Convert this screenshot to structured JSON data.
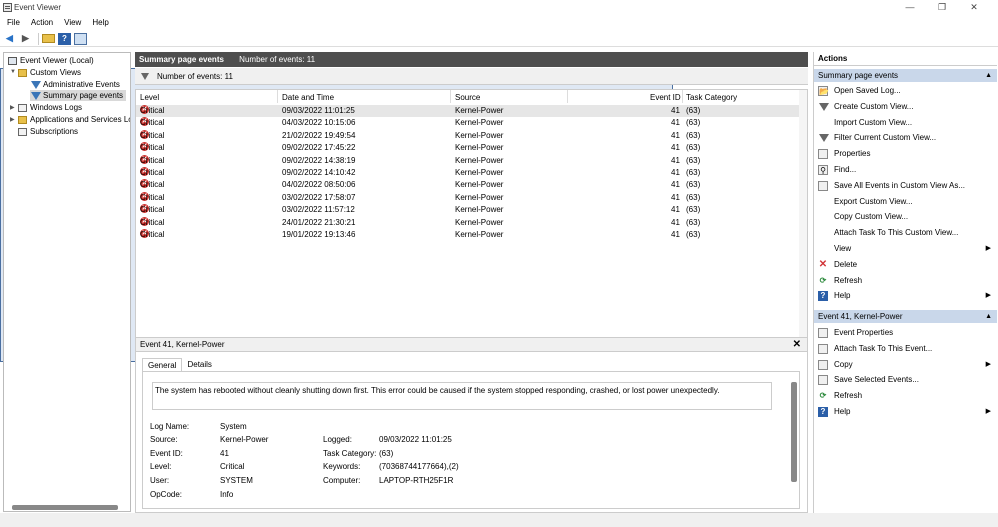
{
  "window": {
    "title": "Event Viewer",
    "controls": [
      "—",
      "❐",
      "✕"
    ]
  },
  "menu": [
    "File",
    "Action",
    "View",
    "Help"
  ],
  "tree": {
    "root": "Event Viewer (Local)",
    "custom_views": "Custom Views",
    "admin_events": "Administrative Events",
    "summary": "Summary page events",
    "windows_logs": "Windows Logs",
    "app_services": "Applications and Services Logs",
    "subscriptions": "Subscriptions"
  },
  "center": {
    "title": "Summary page events",
    "count_label": "Number of events: 11",
    "filter_label": "Number of events: 11",
    "columns": [
      "Level",
      "Date and Time",
      "Source",
      "Event ID",
      "Task Category"
    ],
    "rows": [
      {
        "level": "Critical",
        "datetime": "09/03/2022 11:01:25",
        "source": "Kernel-Power",
        "id": "41",
        "cat": "(63)"
      },
      {
        "level": "Critical",
        "datetime": "04/03/2022 10:15:06",
        "source": "Kernel-Power",
        "id": "41",
        "cat": "(63)"
      },
      {
        "level": "Critical",
        "datetime": "21/02/2022 19:49:54",
        "source": "Kernel-Power",
        "id": "41",
        "cat": "(63)"
      },
      {
        "level": "Critical",
        "datetime": "09/02/2022 17:45:22",
        "source": "Kernel-Power",
        "id": "41",
        "cat": "(63)"
      },
      {
        "level": "Critical",
        "datetime": "09/02/2022 14:38:19",
        "source": "Kernel-Power",
        "id": "41",
        "cat": "(63)"
      },
      {
        "level": "Critical",
        "datetime": "09/02/2022 14:10:42",
        "source": "Kernel-Power",
        "id": "41",
        "cat": "(63)"
      },
      {
        "level": "Critical",
        "datetime": "04/02/2022 08:50:06",
        "source": "Kernel-Power",
        "id": "41",
        "cat": "(63)"
      },
      {
        "level": "Critical",
        "datetime": "03/02/2022 17:58:07",
        "source": "Kernel-Power",
        "id": "41",
        "cat": "(63)"
      },
      {
        "level": "Critical",
        "datetime": "03/02/2022 11:57:12",
        "source": "Kernel-Power",
        "id": "41",
        "cat": "(63)"
      },
      {
        "level": "Critical",
        "datetime": "24/01/2022 21:30:21",
        "source": "Kernel-Power",
        "id": "41",
        "cat": "(63)"
      },
      {
        "level": "Critical",
        "datetime": "19/01/2022 19:13:46",
        "source": "Kernel-Power",
        "id": "41",
        "cat": "(63)"
      }
    ]
  },
  "detail": {
    "title": "Event 41, Kernel-Power",
    "tabs": [
      "General",
      "Details"
    ],
    "message": "The system has rebooted without cleanly shutting down first. This error could be caused if the system stopped responding, crashed, or lost power unexpectedly.",
    "log_name_label": "Log Name:",
    "log_name": "System",
    "source_label": "Source:",
    "source": "Kernel-Power",
    "event_id_label": "Event ID:",
    "event_id": "41",
    "level_label": "Level:",
    "level": "Critical",
    "user_label": "User:",
    "user": "SYSTEM",
    "opcode_label": "OpCode:",
    "opcode": "Info",
    "logged_label": "Logged:",
    "logged": "09/03/2022 11:01:25",
    "task_label": "Task Category:",
    "task": "(63)",
    "keywords_label": "Keywords:",
    "keywords": "(70368744177664),(2)",
    "computer_label": "Computer:",
    "computer": "LAPTOP-RTH25F1R"
  },
  "actions": {
    "title": "Actions",
    "section1": "Summary page events",
    "items1": [
      "Open Saved Log...",
      "Create Custom View...",
      "Import Custom View...",
      "Filter Current Custom View...",
      "Properties",
      "Find...",
      "Save All Events in Custom View As...",
      "Export Custom View...",
      "Copy Custom View...",
      "Attach Task To This Custom View...",
      "View",
      "Delete",
      "Refresh",
      "Help"
    ],
    "section2": "Event 41, Kernel-Power",
    "items2": [
      "Event Properties",
      "Attach Task To This Event...",
      "Copy",
      "Save Selected Events...",
      "Refresh",
      "Help"
    ]
  },
  "colors": {
    "header_bg": "#4e4e4e",
    "section_bg": "#c9d7ea",
    "critical": "#c9302c"
  }
}
